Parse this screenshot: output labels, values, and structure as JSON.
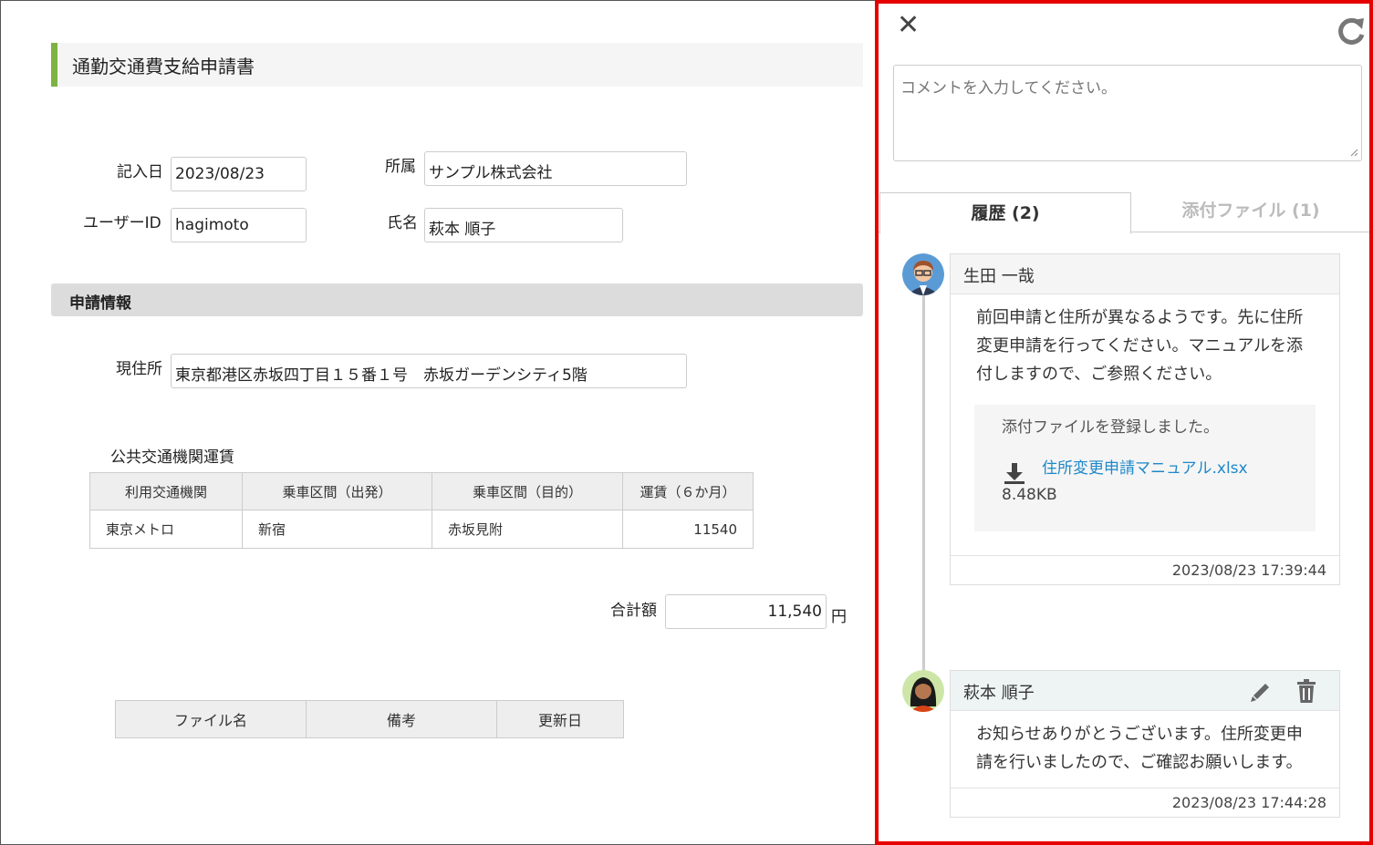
{
  "form": {
    "title": "通勤交通費支給申請書",
    "entry_date_label": "記入日",
    "entry_date_value": "2023/08/23",
    "department_label": "所属",
    "department_value": "サンプル株式会社",
    "user_id_label": "ユーザーID",
    "user_id_value": "hagimoto",
    "name_label": "氏名",
    "name_value": "萩本 順子",
    "section_title": "申請情報",
    "address_label": "現住所",
    "address_value": "東京都港区赤坂四丁目１５番１号　赤坂ガーデンシティ5階",
    "fare_heading": "公共交通機関運賃",
    "fare_table": {
      "headers": [
        "利用交通機関",
        "乗車区間（出発）",
        "乗車区間（目的）",
        "運賃（６か月）"
      ],
      "rows": [
        [
          "東京メトロ",
          "新宿",
          "赤坂見附",
          "11540"
        ]
      ]
    },
    "total_label": "合計額",
    "total_value": "11,540",
    "total_unit": "円",
    "files_table": {
      "headers": [
        "ファイル名",
        "備考",
        "更新日"
      ]
    }
  },
  "panel": {
    "comment_placeholder": "コメントを入力してください。",
    "tabs": [
      {
        "label": "履歴 (2)",
        "active": true
      },
      {
        "label": "添付ファイル (1)",
        "active": false
      }
    ],
    "comments": [
      {
        "author": "生田 一哉",
        "body": "前回申請と住所が異なるようです。先に住所変更申請を行ってください。マニュアルを添付しますので、ご参照ください。",
        "attachment_note": "添付ファイルを登録しました。",
        "attachment_name": "住所変更申請マニュアル.xlsx",
        "attachment_size": "8.48KB",
        "timestamp": "2023/08/23 17:39:44"
      },
      {
        "author": "萩本 順子",
        "body": "お知らせありがとうございます。住所変更申請を行いましたので、ご確認お願いします。",
        "timestamp": "2023/08/23 17:44:28"
      }
    ],
    "highlight_color": "#e60000",
    "link_color": "#1e88c9",
    "accent_color": "#7cb342"
  }
}
